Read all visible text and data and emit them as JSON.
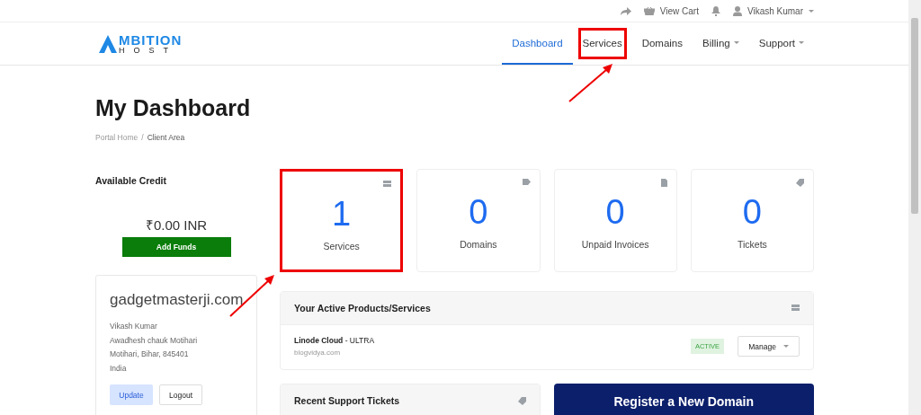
{
  "topbar": {
    "view_cart": "View Cart",
    "user": "Vikash Kumar"
  },
  "logo": {
    "line_1": "MBITION",
    "line_2": "HOST"
  },
  "nav": [
    {
      "label": "Dashboard",
      "selected": true,
      "highlighted": false,
      "dropdown": false
    },
    {
      "label": "Services",
      "selected": false,
      "highlighted": true,
      "dropdown": false
    },
    {
      "label": "Domains",
      "selected": false,
      "highlighted": false,
      "dropdown": false
    },
    {
      "label": "Billing",
      "selected": false,
      "highlighted": false,
      "dropdown": true
    },
    {
      "label": "Support",
      "selected": false,
      "highlighted": false,
      "dropdown": true
    }
  ],
  "page_title": "My Dashboard",
  "breadcrumb": [
    "Portal Home",
    "Client Area"
  ],
  "breadcrumb_separator": "/",
  "credit": {
    "title": "Available Credit",
    "amount": "₹0.00 INR",
    "button": "Add Funds"
  },
  "client": {
    "name": "gadgetmasterji.com",
    "lines": [
      "Vikash Kumar",
      "Awadhesh chauk Motihari",
      "Motihari, Bihar, 845401",
      "India"
    ],
    "update": "Update",
    "logout": "Logout"
  },
  "stats": [
    {
      "kind": "services",
      "value": "1",
      "label": "Services",
      "highlighted": true
    },
    {
      "kind": "domains",
      "value": "0",
      "label": "Domains",
      "highlighted": false
    },
    {
      "kind": "invoices",
      "value": "0",
      "label": "Unpaid Invoices",
      "highlighted": false
    },
    {
      "kind": "tickets",
      "value": "0",
      "label": "Tickets",
      "highlighted": false
    }
  ],
  "products": {
    "title": "Your Active Products/Services",
    "items": [
      {
        "name": "Linode Cloud",
        "plan": " - ULTRA",
        "domain": "blogvidya.com",
        "status": "ACTIVE",
        "action": "Manage"
      }
    ]
  },
  "tickets_panel": {
    "title": "Recent Support Tickets"
  },
  "domain_banner": {
    "title": "Register a New Domain"
  }
}
